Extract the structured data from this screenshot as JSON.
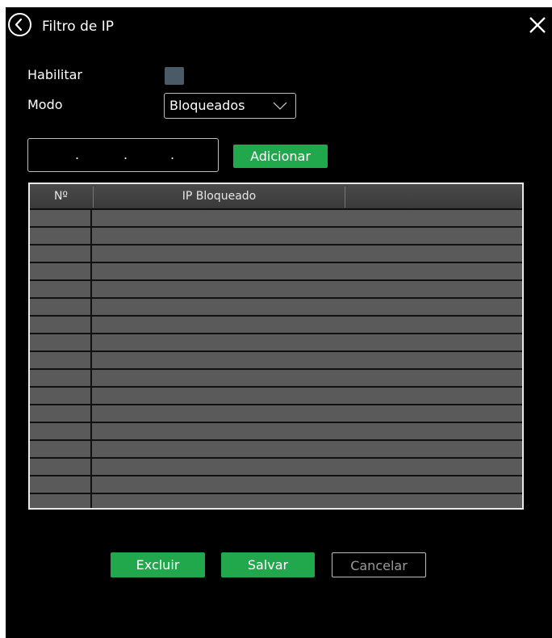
{
  "window": {
    "title": "Filtro de IP"
  },
  "form": {
    "enable_label": "Habilitar",
    "enabled": false,
    "mode_label": "Modo",
    "mode_value": "Bloqueados",
    "ip_value": "",
    "ip_separator": ".",
    "add_label": "Adicionar"
  },
  "table": {
    "columns": [
      "Nº",
      "IP Bloqueado"
    ],
    "rows": [
      [],
      [],
      [],
      [],
      [],
      [],
      [],
      [],
      [],
      [],
      [],
      [],
      [],
      [],
      [],
      [],
      []
    ]
  },
  "footer": {
    "delete_label": "Excluir",
    "save_label": "Salvar",
    "cancel_label": "Cancelar"
  },
  "colors": {
    "background": "#000000",
    "accent_green": "#22a84c",
    "table_row": "#5a5a5a",
    "checkbox": "#4a5a66"
  },
  "icons": {
    "back": "back-arrow-circle-icon",
    "close": "close-x-icon",
    "dropdown": "chevron-down-icon"
  }
}
